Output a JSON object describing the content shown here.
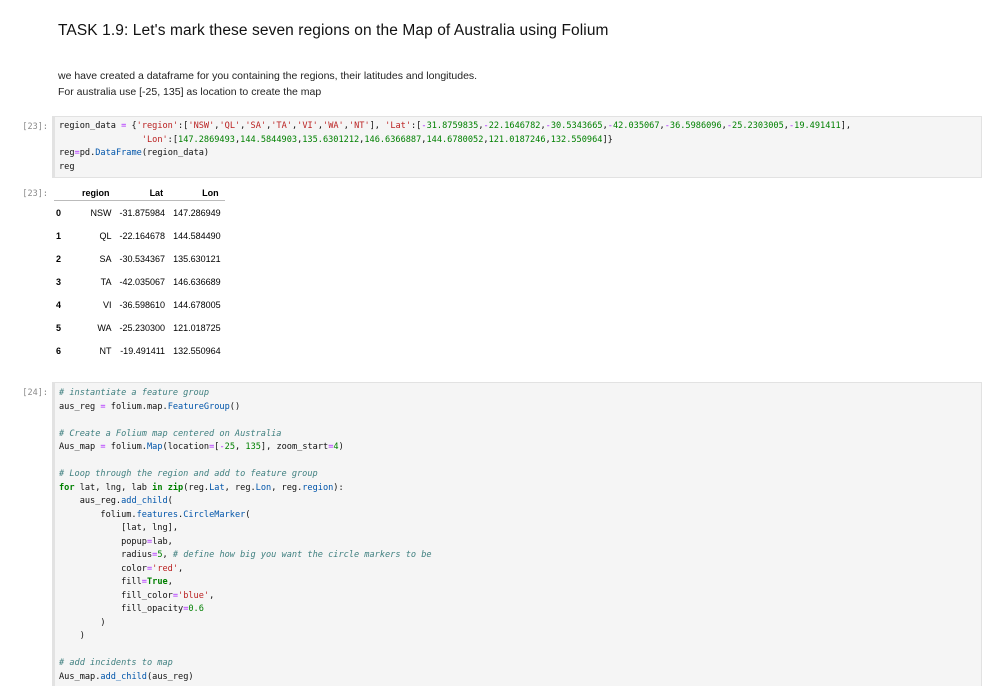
{
  "title": "TASK 1.9: Let's mark these seven regions on the Map of Australia using Folium",
  "description": [
    "we have created a dataframe for you containing the regions, their latitudes and longitudes.",
    "For australia use [-25, 135] as location to create the map"
  ],
  "cells": {
    "cell1": {
      "prompt_in": "[23]:",
      "prompt_out": "[23]:"
    },
    "cell2": {
      "prompt_in": "[24]:"
    }
  },
  "dataframe": {
    "columns": [
      "region",
      "Lat",
      "Lon"
    ],
    "rows": [
      {
        "idx": "0",
        "region": "NSW",
        "lat": "-31.875984",
        "lon": "147.286949"
      },
      {
        "idx": "1",
        "region": "QL",
        "lat": "-22.164678",
        "lon": "144.584490"
      },
      {
        "idx": "2",
        "region": "SA",
        "lat": "-30.534367",
        "lon": "135.630121"
      },
      {
        "idx": "3",
        "region": "TA",
        "lat": "-42.035067",
        "lon": "146.636689"
      },
      {
        "idx": "4",
        "region": "VI",
        "lat": "-36.598610",
        "lon": "144.678005"
      },
      {
        "idx": "5",
        "region": "WA",
        "lat": "-25.230300",
        "lon": "121.018725"
      },
      {
        "idx": "6",
        "region": "NT",
        "lat": "-19.491411",
        "lon": "132.550964"
      }
    ]
  }
}
